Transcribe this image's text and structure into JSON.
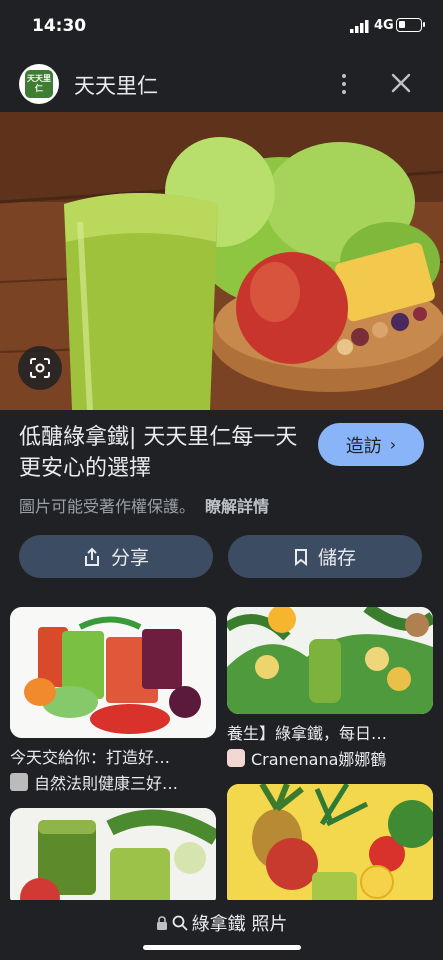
{
  "status_bar": {
    "time": "14:30",
    "network": "4G"
  },
  "header": {
    "site_name": "天天里仁",
    "logo_text": "天天里仁"
  },
  "result": {
    "title": "低醣綠拿鐵| 天天里仁每一天更安心的選擇",
    "visit_label": "造訪",
    "copyright_notice": "圖片可能受著作權保護。",
    "learn_more": "瞭解詳情"
  },
  "actions": {
    "share_label": "分享",
    "save_label": "儲存"
  },
  "related": [
    {
      "caption": "今天交給你：打造好…",
      "source": "自然法則健康三好…"
    },
    {
      "caption": "養生】綠拿鐵，每日…",
      "source": "Cranenana娜娜鶴"
    },
    {
      "caption": "",
      "source": ""
    },
    {
      "caption": "",
      "source": ""
    }
  ],
  "bottom_bar": {
    "label": "綠拿鐵 照片"
  },
  "colors": {
    "background": "#202124",
    "accent": "#8ab4f8",
    "button_bg": "#3c4c63"
  },
  "icons": [
    "signal-icon",
    "battery-icon",
    "more-vert-icon",
    "close-icon",
    "lens-icon",
    "share-icon",
    "bookmark-icon",
    "lock-icon",
    "search-icon",
    "chevron-right-icon"
  ]
}
